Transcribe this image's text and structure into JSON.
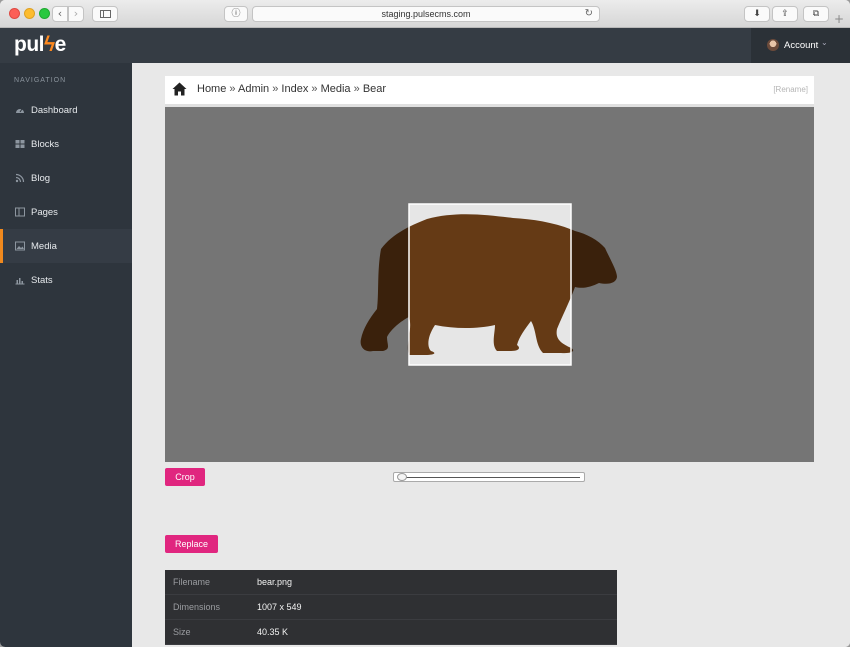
{
  "browser": {
    "url": "staging.pulsecms.com"
  },
  "app": {
    "logo_pre": "pul",
    "logo_post": "e",
    "account_label": "Account"
  },
  "sidebar": {
    "heading": "NAVIGATION",
    "items": [
      {
        "label": "Dashboard",
        "icon": "dashboard-icon"
      },
      {
        "label": "Blocks",
        "icon": "blocks-icon"
      },
      {
        "label": "Blog",
        "icon": "rss-icon"
      },
      {
        "label": "Pages",
        "icon": "pages-icon"
      },
      {
        "label": "Media",
        "icon": "image-icon",
        "active": true
      },
      {
        "label": "Stats",
        "icon": "chart-icon"
      }
    ]
  },
  "breadcrumb": {
    "items": [
      "Home",
      "Admin",
      "Index",
      "Media",
      "Bear"
    ],
    "separator": "»",
    "rename_label": "[Rename]"
  },
  "editor": {
    "crop_label": "Crop",
    "replace_label": "Replace",
    "zoom_value": 0
  },
  "file_info": [
    {
      "key": "Filename",
      "value": "bear.png"
    },
    {
      "key": "Dimensions",
      "value": "1007 x 549"
    },
    {
      "key": "Size",
      "value": "40.35 K"
    }
  ],
  "colors": {
    "accent": "#e0267f",
    "sidebar_active": "#f0891e",
    "header": "#353c44",
    "bear": "#653a15"
  }
}
